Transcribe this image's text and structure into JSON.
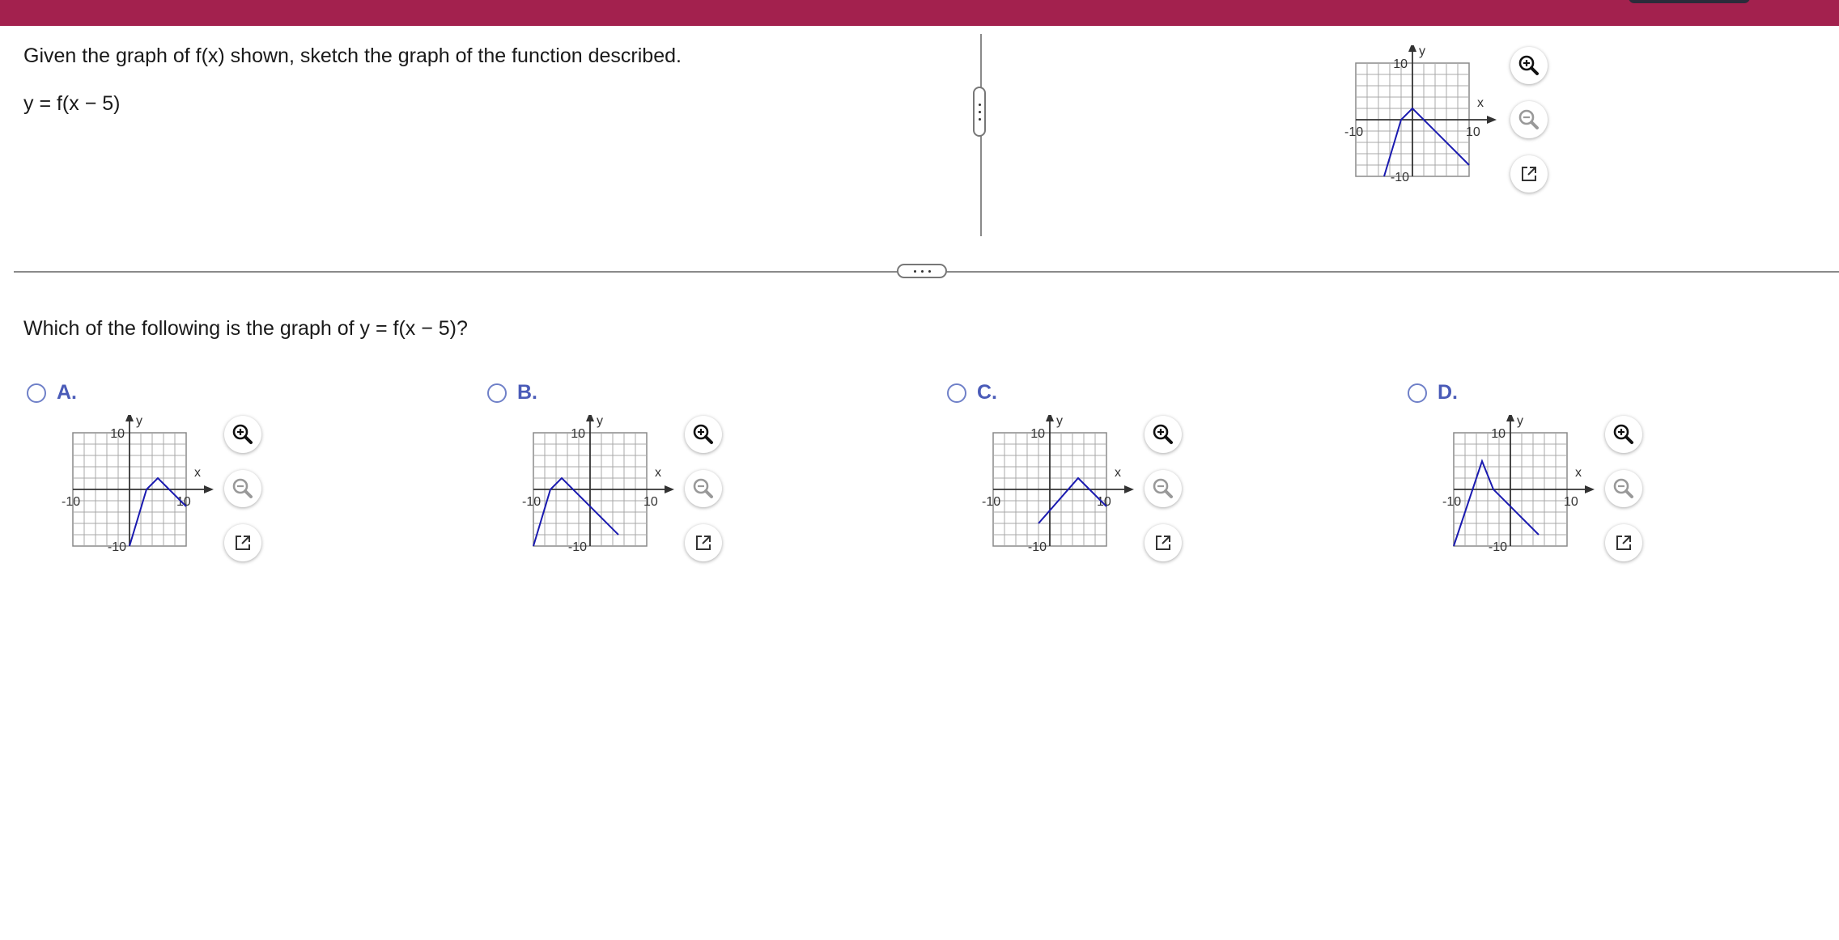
{
  "colors": {
    "header_bar": "#a3214e",
    "accent": "#4a5bb8",
    "curve": "#1a1ab0"
  },
  "question": {
    "instruction": "Given the graph of f(x) shown, sketch the graph of the function described.",
    "function": "y = f(x − 5)",
    "prompt": "Which of the following is the graph of y = f(x − 5)?"
  },
  "icons": {
    "zoom_in": "zoom-in-icon",
    "zoom_out": "zoom-out-icon",
    "open_new": "open-external-icon"
  },
  "graph_labels": {
    "y_axis": "y",
    "x_axis": "x",
    "x_min": "-10",
    "x_max": "10",
    "y_max": "10",
    "y_min": "-10"
  },
  "reference_graph": {
    "label_style": "full",
    "points": [
      [
        -5,
        -10
      ],
      [
        -2,
        0
      ],
      [
        0,
        2
      ],
      [
        10,
        -8
      ]
    ]
  },
  "options": [
    {
      "label": "A.",
      "label_style": "compact",
      "points": [
        [
          0,
          -10
        ],
        [
          3,
          0
        ],
        [
          5,
          2
        ],
        [
          10,
          -3
        ]
      ]
    },
    {
      "label": "B.",
      "label_style": "full",
      "points": [
        [
          -10,
          -10
        ],
        [
          -7,
          0
        ],
        [
          -5,
          2
        ],
        [
          5,
          -8
        ]
      ]
    },
    {
      "label": "C.",
      "label_style": "compact",
      "points": [
        [
          -2,
          -6
        ],
        [
          5,
          2
        ],
        [
          10,
          -3
        ]
      ]
    },
    {
      "label": "D.",
      "label_style": "full",
      "points": [
        [
          -10,
          -10
        ],
        [
          -5,
          5
        ],
        [
          -3,
          0
        ],
        [
          5,
          -8
        ]
      ]
    }
  ]
}
